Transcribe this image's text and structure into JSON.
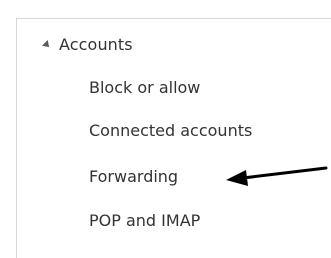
{
  "nav": {
    "section": {
      "label": "Accounts",
      "icon": "triangle-expanded-icon"
    },
    "items": [
      {
        "label": "Block or allow"
      },
      {
        "label": "Connected accounts"
      },
      {
        "label": "Forwarding"
      },
      {
        "label": "POP and IMAP"
      }
    ]
  },
  "annotation": {
    "icon": "arrow-left-icon",
    "color": "#000000"
  }
}
